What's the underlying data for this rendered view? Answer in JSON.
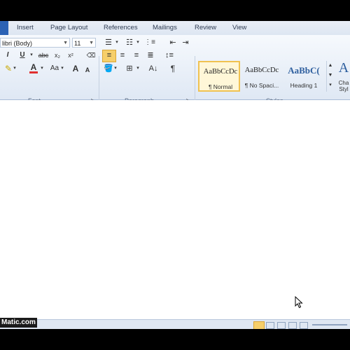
{
  "tabs": [
    "Insert",
    "Page Layout",
    "References",
    "Mailings",
    "Review",
    "View"
  ],
  "font": {
    "family_value": "libri (Body)",
    "size_value": "11",
    "group_label": "Font"
  },
  "paragraph": {
    "group_label": "Paragraph"
  },
  "styles": {
    "group_label": "Styles",
    "items": [
      {
        "sample": "AaBbCcDc",
        "name": "¶ Normal"
      },
      {
        "sample": "AaBbCcDc",
        "name": "¶ No Spaci..."
      },
      {
        "sample": "AaBbC(",
        "name": "Heading 1"
      }
    ],
    "change_label": "Cha Styl"
  },
  "watermark": "Matic.com",
  "colors": {
    "tab_file": "#2b62b5",
    "highlight": "#f0c250",
    "font_color": "#e03030",
    "highlighter": "#f5e900"
  }
}
